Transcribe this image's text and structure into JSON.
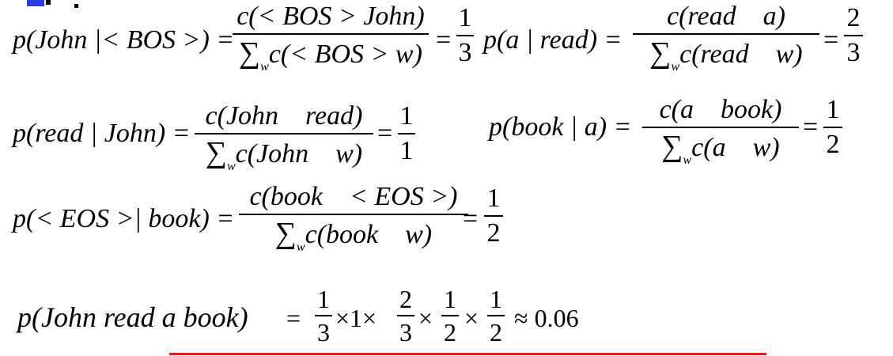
{
  "colors": {
    "underline": "#e0201f",
    "corner_mark": "#2c3be0"
  },
  "eq1": {
    "lhs": "p(John |< BOS >) =",
    "num": "c(< BOS > John)",
    "den": "c(< BOS > w)",
    "eq": "=",
    "rnum": "1",
    "rden": "3"
  },
  "eq2": {
    "lhs": "p(a | read) =",
    "num": "c(read    a)",
    "den": "c(read    w)",
    "eq": "=",
    "rnum": "2",
    "rden": "3"
  },
  "eq3": {
    "lhs": "p(read | John) =",
    "num": "c(John    read)",
    "den": "c(John    w)",
    "eq": "=",
    "rnum": "1",
    "rden": "1"
  },
  "eq4": {
    "lhs": "p(book | a) =",
    "num": "c(a    book)",
    "den": "c(a    w)",
    "eq": "=",
    "rnum": "1",
    "rden": "2"
  },
  "eq5": {
    "lhs": "p(< EOS >| book) =",
    "num": "c(book    < EOS >)",
    "den": "c(book    w)",
    "eq": "=",
    "rnum": "1",
    "rden": "2"
  },
  "sum_symbol": "∑",
  "sum_sub": "w",
  "final": {
    "lhs": "p(John read a book)",
    "eq": "=",
    "f1": {
      "num": "1",
      "den": "3"
    },
    "times1": "×1×",
    "f2": {
      "num": "2",
      "den": "3"
    },
    "times2": "×",
    "f3": {
      "num": "1",
      "den": "2"
    },
    "times3": "×",
    "f4": {
      "num": "1",
      "den": "2"
    },
    "result": "≈ 0.06"
  }
}
